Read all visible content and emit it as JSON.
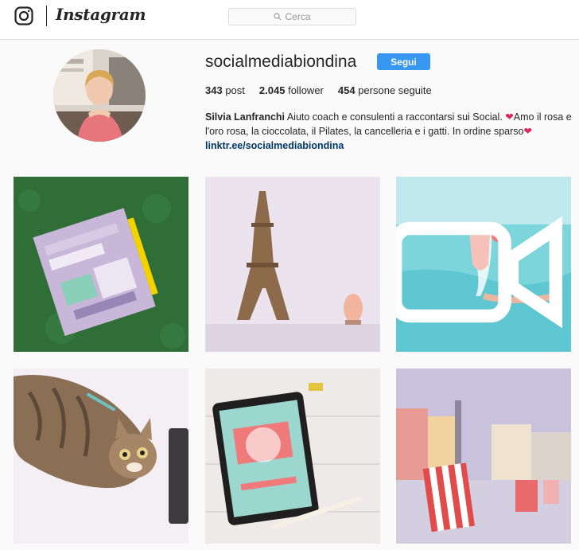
{
  "nav": {
    "brand": "Instagram",
    "logo_icon": "instagram-camera-icon",
    "search_placeholder": "Cerca",
    "search_icon": "search-icon"
  },
  "profile": {
    "username": "socialmediabiondina",
    "follow_label": "Segui",
    "posts_count": "343",
    "posts_label": "post",
    "followers_count": "2.045",
    "followers_label": "follower",
    "following_count": "454",
    "following_label": "persone seguite",
    "full_name": "Silvia Lanfranchi",
    "bio_line1": "Aiuto coach e consulenti a raccontarsi sui Social. ",
    "bio_heart": "❤",
    "bio_line2": "Amo il rosa e l'oro rosa, la cioccolata, il Pilates, la cancelleria e i gatti. In ordine sparso",
    "link": "linktr.ee/socialmediabiondina"
  },
  "posts": [
    {
      "subject": "grand-brilliance-magazine-on-grass"
    },
    {
      "subject": "eiffel-tower-figurine"
    },
    {
      "subject": "wine-glass-in-pool",
      "badge_icon": "video-camera-icon"
    },
    {
      "subject": "tabby-cat-on-desk"
    },
    {
      "subject": "insta-branding-ebook-tablet"
    },
    {
      "subject": "beach-chairs-in-piazza"
    }
  ],
  "colors": {
    "accent": "#3897f0",
    "link": "#003569",
    "heart": "#e0245e",
    "background": "#fafafa"
  }
}
